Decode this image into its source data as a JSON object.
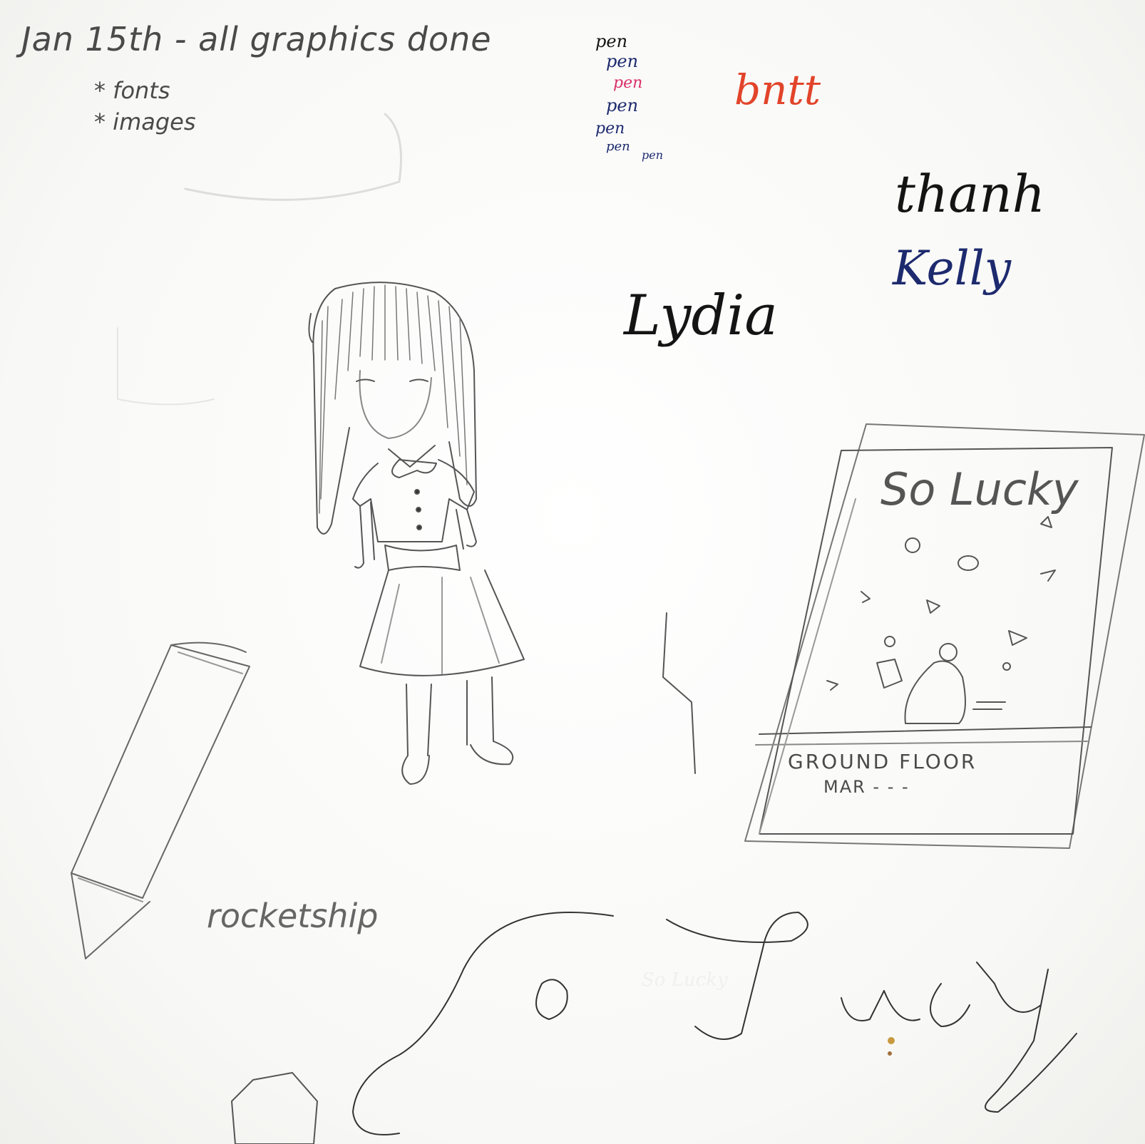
{
  "notes": {
    "deadline": "Jan 15th - all graphics done",
    "item_fonts": "* fonts",
    "item_images": "* images"
  },
  "pen_tests": {
    "line1": "pen",
    "line2": "pen",
    "line3": "pen",
    "line4": "pen",
    "line5": "pen",
    "line6": "pen",
    "line7": "pen",
    "red_word": "bntt"
  },
  "names": {
    "thanh": "thanh",
    "kelly": "Kelly",
    "lydia": "Lydia"
  },
  "poster": {
    "title": "So Lucky",
    "floor": "GROUND FLOOR",
    "sub": "MAR - - -"
  },
  "labels": {
    "rocketship": "rocketship",
    "big_title": "So Lucky"
  },
  "colors": {
    "pencil": "#4a4a4a",
    "black_ink": "#141414",
    "navy_ink": "#1d2a6e",
    "red_ink": "#e2442a",
    "pink_ink": "#d8306a"
  }
}
